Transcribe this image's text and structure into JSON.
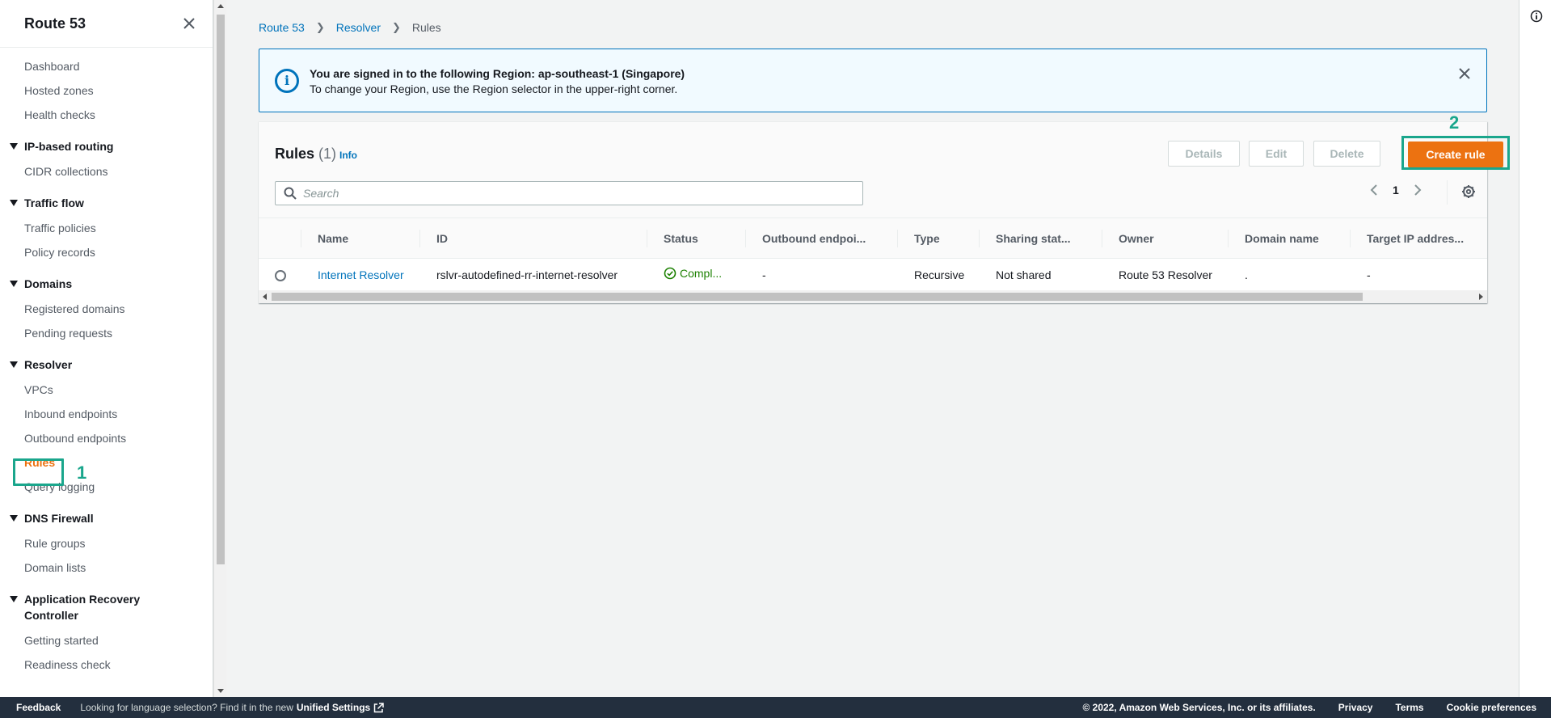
{
  "sidebar": {
    "title": "Route 53",
    "close_icon": "close-icon",
    "top_items": [
      "Dashboard",
      "Hosted zones",
      "Health checks"
    ],
    "sections": [
      {
        "label": "IP-based routing",
        "items": [
          "CIDR collections"
        ]
      },
      {
        "label": "Traffic flow",
        "items": [
          "Traffic policies",
          "Policy records"
        ]
      },
      {
        "label": "Domains",
        "items": [
          "Registered domains",
          "Pending requests"
        ]
      },
      {
        "label": "Resolver",
        "items": [
          "VPCs",
          "Inbound endpoints",
          "Outbound endpoints",
          "Rules",
          "Query logging"
        ]
      },
      {
        "label": "DNS Firewall",
        "items": [
          "Rule groups",
          "Domain lists"
        ]
      },
      {
        "label": "Application Recovery Controller",
        "items": [
          "Getting started",
          "Readiness check"
        ]
      }
    ],
    "active_item": "Rules",
    "annotation": "1"
  },
  "breadcrumb": {
    "items": [
      "Route 53",
      "Resolver"
    ],
    "current": "Rules"
  },
  "flash": {
    "title": "You are signed in to the following Region: ap-southeast-1 (Singapore)",
    "message": "To change your Region, use the Region selector in the upper-right corner.",
    "icon": "info-icon",
    "accent": "#0073bb"
  },
  "panel": {
    "title": "Rules",
    "count": "(1)",
    "info": "Info",
    "buttons": {
      "details": "Details",
      "edit": "Edit",
      "delete": "Delete",
      "create": "Create rule"
    },
    "annotation": "2",
    "search_placeholder": "Search",
    "page": "1",
    "columns": [
      "Name",
      "ID",
      "Status",
      "Outbound endpoi...",
      "Type",
      "Sharing stat...",
      "Owner",
      "Domain name",
      "Target IP addres..."
    ],
    "rows": [
      {
        "name": "Internet Resolver",
        "id": "rslvr-autodefined-rr-internet-resolver",
        "status": "Compl...",
        "outbound": "-",
        "type": "Recursive",
        "sharing": "Not shared",
        "owner": "Route 53 Resolver",
        "domain": ".",
        "target": "-"
      }
    ]
  },
  "footer": {
    "feedback": "Feedback",
    "lang": "Looking for language selection? Find it in the new",
    "unified": "Unified Settings",
    "copyright": "© 2022, Amazon Web Services, Inc. or its affiliates.",
    "privacy": "Privacy",
    "terms": "Terms",
    "cookies": "Cookie preferences"
  },
  "colors": {
    "brand_orange": "#ec7211",
    "link": "#0073bb",
    "annotation": "#1aa68c",
    "success": "#1d8102",
    "footer_bg": "#232f3e"
  }
}
